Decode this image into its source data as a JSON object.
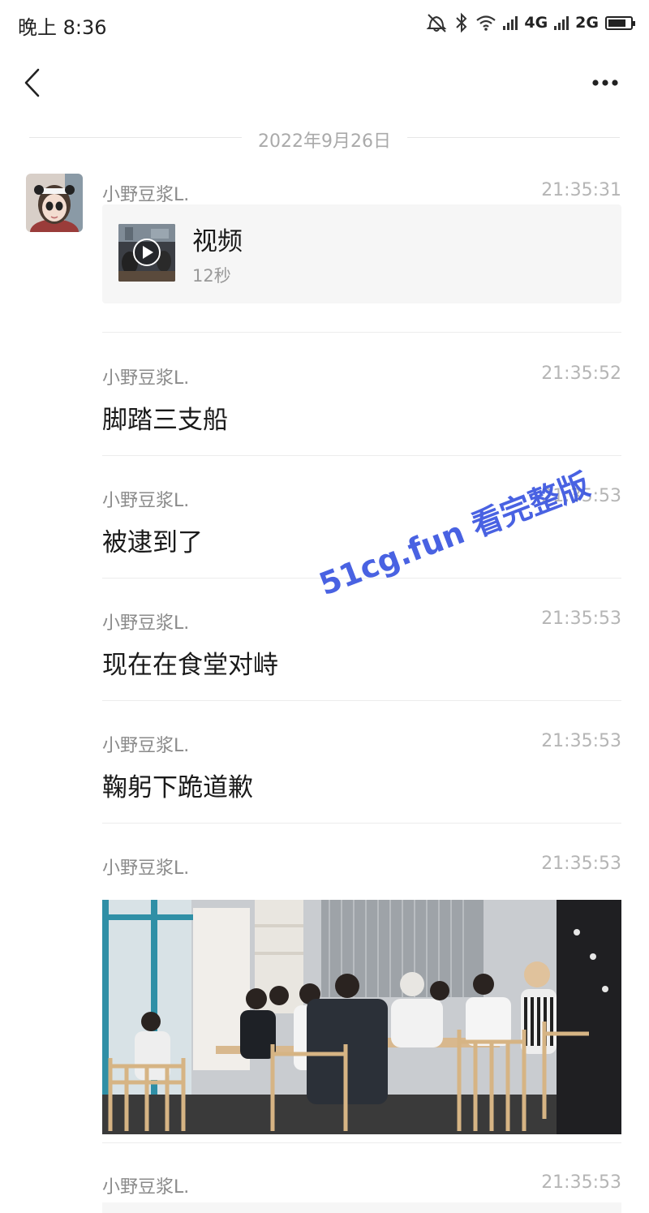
{
  "status_bar": {
    "time": "晚上 8:36",
    "network_1": "4G",
    "network_2": "2G",
    "icons": [
      "alarm-off-icon",
      "bluetooth-icon",
      "wifi-icon",
      "signal-icon",
      "signal-icon",
      "battery-icon"
    ],
    "battery_level": 0.7
  },
  "nav": {
    "back_icon": "chevron-left-icon",
    "more_icon": "more-horizontal-icon"
  },
  "date_separator": "2022年9月26日",
  "messages": [
    {
      "sender": "小野豆浆L.",
      "time": "21:35:31",
      "type": "video",
      "title": "视频",
      "duration": "12秒"
    },
    {
      "sender": "小野豆浆L.",
      "time": "21:35:52",
      "type": "text",
      "text": "脚踏三支船"
    },
    {
      "sender": "小野豆浆L.",
      "time": "21:35:53",
      "type": "text",
      "text": "被逮到了"
    },
    {
      "sender": "小野豆浆L.",
      "time": "21:35:53",
      "type": "text",
      "text": "现在在食堂对峙"
    },
    {
      "sender": "小野豆浆L.",
      "time": "21:35:53",
      "type": "text",
      "text": "鞠躬下跪道歉"
    },
    {
      "sender": "小野豆浆L.",
      "time": "21:35:53",
      "type": "image"
    },
    {
      "sender": "小野豆浆L.",
      "time": "21:35:53",
      "type": "partial"
    }
  ],
  "watermark": {
    "text": "51cg.fun 看完整版",
    "color": "#3a55e0"
  },
  "colors": {
    "background": "#ffffff",
    "meta_text": "#8a8a8a",
    "time_text": "#b5b5b5",
    "card_bg": "#f6f6f6"
  }
}
